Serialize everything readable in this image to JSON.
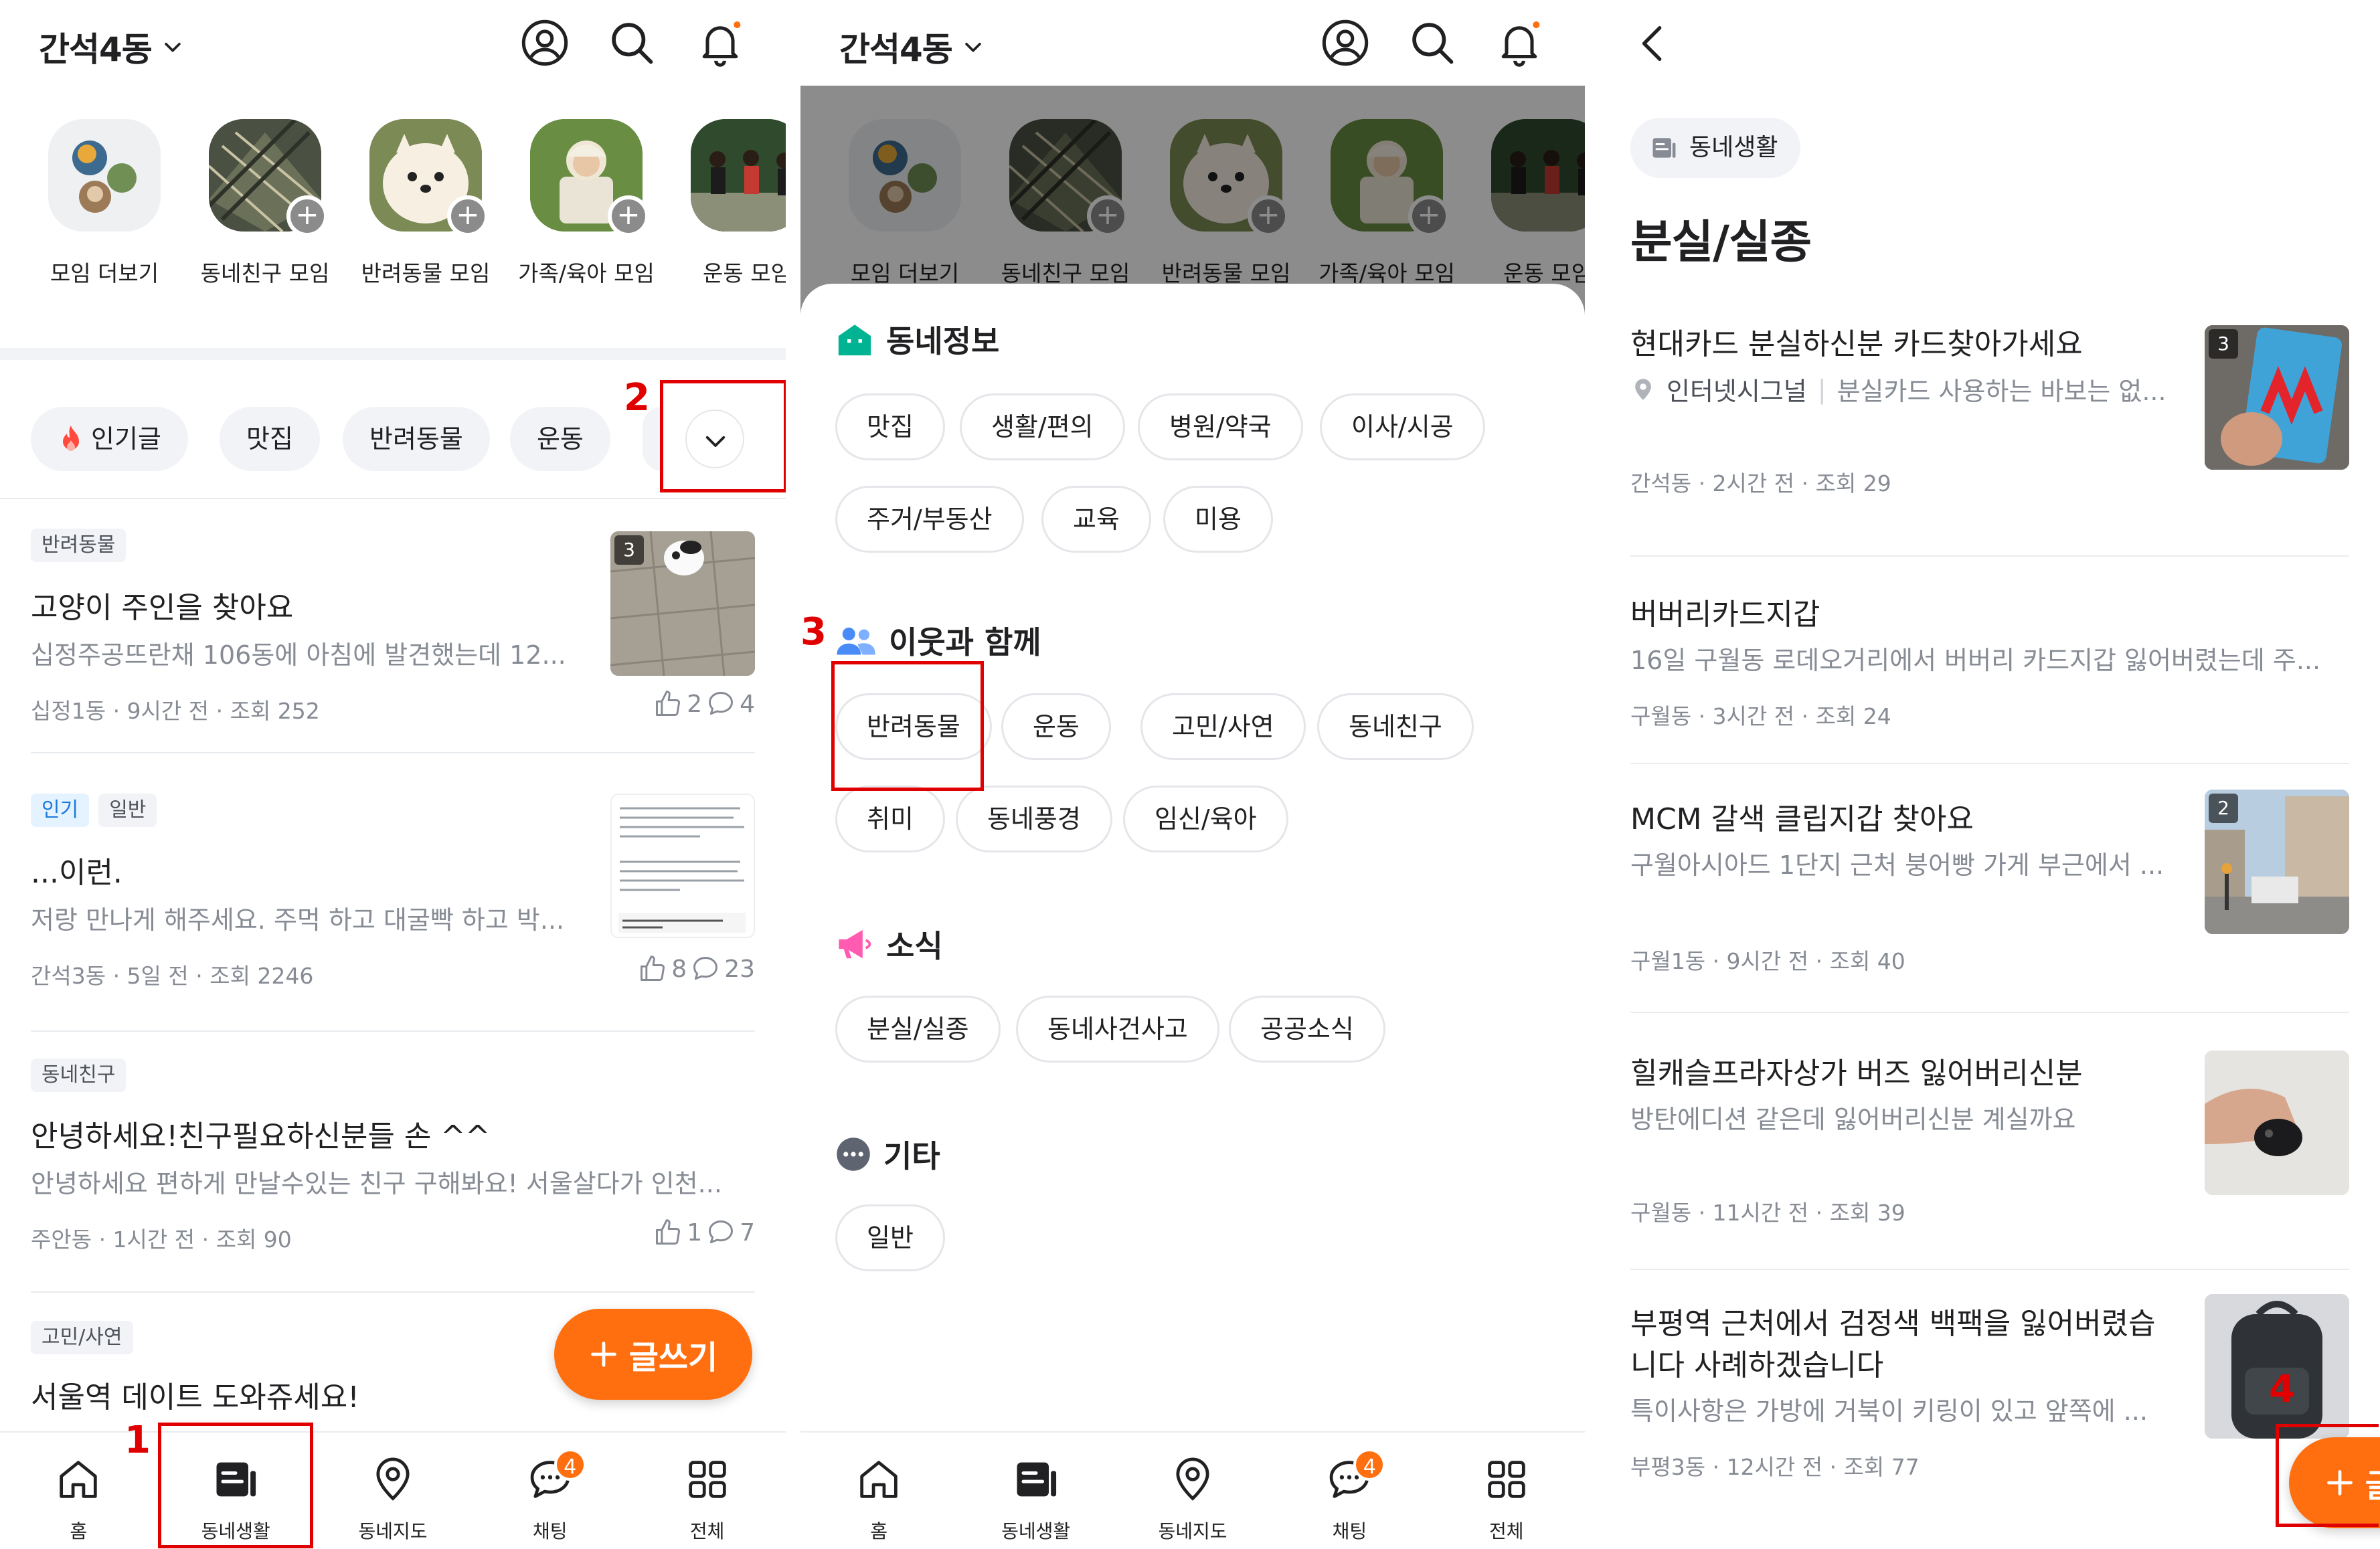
{
  "panel1": {
    "location": "간석4동",
    "stories": [
      {
        "label": "모임 더보기"
      },
      {
        "label": "동네친구 모임"
      },
      {
        "label": "반려동물 모임"
      },
      {
        "label": "가족/육아 모임"
      },
      {
        "label": "운동 모임"
      }
    ],
    "chips": [
      "인기글",
      "맛집",
      "반려동물",
      "운동"
    ],
    "posts": [
      {
        "tags": [
          "반려동물"
        ],
        "title": "고양이 주인을 찾아요",
        "body": "십정주공뜨란채 106동에 아침에 발견했는데 12...",
        "meta": "십정1동 · 9시간 전 · 조회 252",
        "likes": "2",
        "comments": "4",
        "image_count": "3"
      },
      {
        "tags": [
          "인기",
          "일반"
        ],
        "title": "...이런.",
        "body": "저랑 만나게 해주세요. 주먹 하고 대굴빡 하고 박...",
        "meta": "간석3동 · 5일 전 · 조회 2246",
        "likes": "8",
        "comments": "23"
      },
      {
        "tags": [
          "동네친구"
        ],
        "title": "안녕하세요!친구필요하신분들 손 ^^",
        "body": "안녕하세요 편하게 만날수있는 친구 구해봐요! 서울살다가 인천...",
        "meta": "주안동 · 1시간 전 · 조회 90",
        "likes": "1",
        "comments": "7"
      },
      {
        "tags": [
          "고민/사연"
        ],
        "title": "서울역 데이트 도와쥬세요!"
      }
    ],
    "fab_label": "글쓰기",
    "annotation_1": "1",
    "annotation_2": "2"
  },
  "nav": {
    "items": [
      {
        "label": "홈",
        "icon": "home-icon"
      },
      {
        "label": "동네생활",
        "icon": "neighborhood-life-icon"
      },
      {
        "label": "동네지도",
        "icon": "map-pin-icon"
      },
      {
        "label": "채팅",
        "icon": "chat-icon",
        "badge": "4"
      },
      {
        "label": "전체",
        "icon": "grid-icon"
      }
    ]
  },
  "panel2": {
    "location": "간석4동",
    "sections": [
      {
        "title": "동네정보",
        "icon": "house-icon",
        "color": "#00b493",
        "chips": [
          "맛집",
          "생활/편의",
          "병원/약국",
          "이사/시공",
          "주거/부동산",
          "교육",
          "미용"
        ]
      },
      {
        "title": "이웃과 함께",
        "icon": "people-icon",
        "color": "#4a8cf7",
        "chips": [
          "반려동물",
          "운동",
          "고민/사연",
          "동네친구",
          "취미",
          "동네풍경",
          "임신/육아"
        ]
      },
      {
        "title": "소식",
        "icon": "megaphone-icon",
        "color": "#ff5bb0",
        "chips": [
          "분실/실종",
          "동네사건사고",
          "공공소식"
        ]
      },
      {
        "title": "기타",
        "icon": "more-icon",
        "color": "#868b94",
        "chips": [
          "일반"
        ]
      }
    ],
    "annotation_3": "3"
  },
  "panel3": {
    "category_badge": "동네생활",
    "list_title": "분실/실종",
    "posts": [
      {
        "title": "현대카드 분실하신분 카드찾아가세요",
        "place": "인터넷시그널",
        "body": "분실카드 사용하는 바보는 없...",
        "meta": "간석동 · 2시간 전 · 조회 29",
        "image_count": "3"
      },
      {
        "title": "버버리카드지갑",
        "body": "16일 구월동 로데오거리에서 버버리 카드지갑 잃어버렸는데 주...",
        "meta": "구월동 · 3시간 전 · 조회 24"
      },
      {
        "title": "MCM 갈색 클립지갑 찾아요",
        "body": "구월아시아드 1단지 근처 붕어빵 가게 부근에서 ...",
        "meta": "구월1동 · 9시간 전 · 조회 40",
        "image_count": "2"
      },
      {
        "title": "힐캐슬프라자상가 버즈 잃어버리신분",
        "body": "방탄에디션 같은데 잃어버리신분 계실까요",
        "meta": "구월동 · 11시간 전 · 조회 39"
      },
      {
        "title_line1": "부평역 근처에서 검정색 백팩을 잃어버렸습",
        "title_line2": "니다 사례하겠습니다",
        "body": "특이사항은 가방에 거북이 키링이 있고 앞쪽에 ...",
        "meta": "부평3동 · 12시간 전 · 조회 77"
      }
    ],
    "fab_label": "글쓰기",
    "annotation_4": "4"
  },
  "colors": {
    "brand": "#ff6f0f",
    "annotation": "#e00000",
    "text": "#212124",
    "subtext": "#868b94"
  }
}
